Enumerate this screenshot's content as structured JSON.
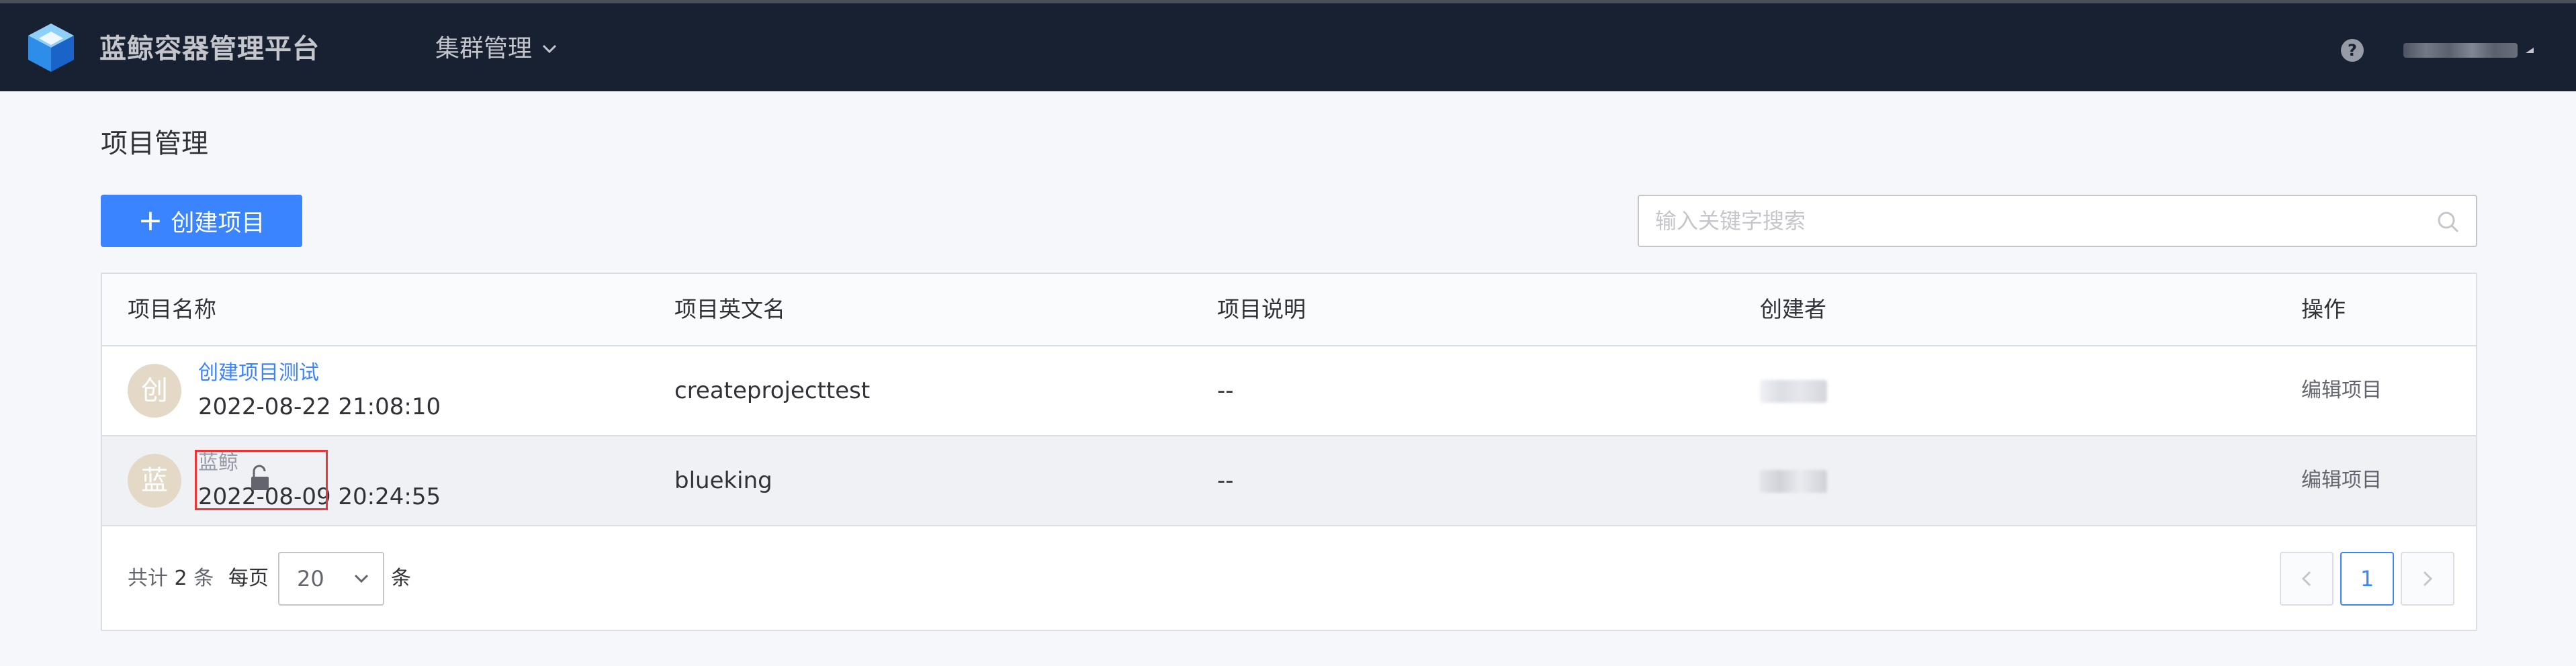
{
  "header": {
    "brand": "蓝鲸容器管理平台",
    "nav_menu": "集群管理",
    "help_icon": "question-circle-icon"
  },
  "page": {
    "title": "项目管理",
    "create_button": "创建项目",
    "search_placeholder": "输入关键字搜索"
  },
  "table": {
    "headers": [
      "项目名称",
      "项目英文名",
      "项目说明",
      "创建者",
      "操作"
    ],
    "rows": [
      {
        "avatar": "创",
        "name": "创建项目测试",
        "created": "2022-08-22 21:08:10",
        "english_name": "createprojecttest",
        "description": "--",
        "action": "编辑项目"
      },
      {
        "avatar": "蓝",
        "name": "蓝鲸",
        "created": "2022-08-09 20:24:55",
        "english_name": "blueking",
        "description": "--",
        "action": "编辑项目"
      }
    ]
  },
  "pagination": {
    "total_prefix": "共计",
    "total": "2",
    "total_suffix": "条",
    "per_page_label": "每页",
    "per_page_value": "20",
    "per_page_unit": "条",
    "current_page": "1"
  },
  "colors": {
    "topbar": "#182132",
    "primary": "#3a84ff",
    "highlight": "#ea3636"
  }
}
